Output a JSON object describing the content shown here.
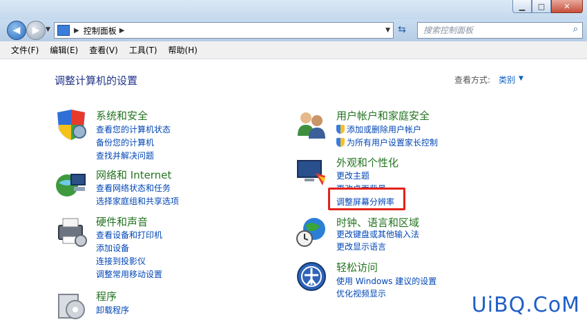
{
  "window": {
    "min_label": "▁",
    "max_label": "□",
    "close_label": "✕"
  },
  "address": {
    "crumb": "控制面板"
  },
  "search": {
    "placeholder": "搜索控制面板"
  },
  "menu": [
    "文件(F)",
    "编辑(E)",
    "查看(V)",
    "工具(T)",
    "帮助(H)"
  ],
  "main": {
    "heading": "调整计算机的设置",
    "view_by_label": "查看方式:",
    "view_by_value": "类别"
  },
  "categories": [
    {
      "title": "系统和安全",
      "links": [
        "查看您的计算机状态",
        "备份您的计算机",
        "查找并解决问题"
      ]
    },
    {
      "title": "网络和 Internet",
      "links": [
        "查看网络状态和任务",
        "选择家庭组和共享选项"
      ]
    },
    {
      "title": "硬件和声音",
      "links": [
        "查看设备和打印机",
        "添加设备",
        "连接到投影仪",
        "调整常用移动设置"
      ]
    },
    {
      "title": "程序",
      "links": [
        "卸载程序"
      ]
    },
    {
      "title": "用户帐户和家庭安全",
      "links": [
        "添加或删除用户帐户",
        "为所有用户设置家长控制"
      ]
    },
    {
      "title": "外观和个性化",
      "links": [
        "更改主题",
        "更改桌面背景",
        "调整屏幕分辨率"
      ]
    },
    {
      "title": "时钟、语言和区域",
      "links": [
        "更改键盘或其他输入法",
        "更改显示语言"
      ]
    },
    {
      "title": "轻松访问",
      "links": [
        "使用 Windows 建议的设置",
        "优化视频显示"
      ]
    }
  ],
  "watermark": "UiBQ.CoM",
  "colors": {
    "category_title": "#22731f",
    "link": "#0046b5",
    "heading": "#1e3287",
    "highlight": "#e32119"
  }
}
